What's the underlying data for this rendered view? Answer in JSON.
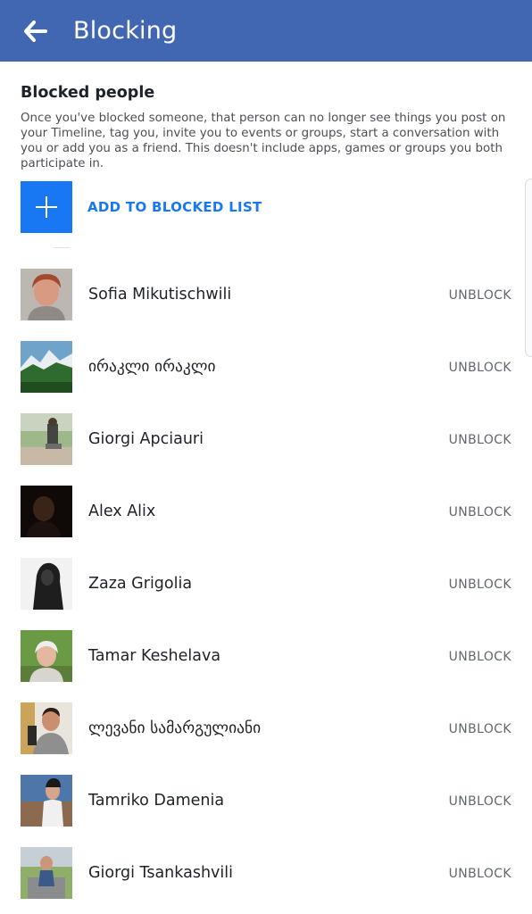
{
  "header": {
    "title": "Blocking",
    "back_icon": "arrow-left-icon",
    "color": "#4267b2"
  },
  "section": {
    "title": "Blocked people",
    "description": "Once you've blocked someone, that person can no longer see things you post on your Timeline, tag you, invite you to events or groups, start a conversation with you or add you as a friend. This doesn't include apps, games or groups you both participate in."
  },
  "add_button": {
    "label": "ADD TO BLOCKED LIST",
    "icon": "plus-icon",
    "color": "#1877f2"
  },
  "blocked": [
    {
      "name": "Sofia Mikutischwili",
      "action": "UNBLOCK"
    },
    {
      "name": "ირაკლი ირაკლი",
      "action": "UNBLOCK"
    },
    {
      "name": "Giorgi Apciauri",
      "action": "UNBLOCK"
    },
    {
      "name": "Alex Alix",
      "action": "UNBLOCK"
    },
    {
      "name": "Zaza Grigolia",
      "action": "UNBLOCK"
    },
    {
      "name": "Tamar Keshelava",
      "action": "UNBLOCK"
    },
    {
      "name": "ლევანი სამარგულიანი",
      "action": "UNBLOCK"
    },
    {
      "name": "Tamriko Damenia",
      "action": "UNBLOCK"
    },
    {
      "name": "Giorgi Tsankashvili",
      "action": "UNBLOCK"
    }
  ]
}
